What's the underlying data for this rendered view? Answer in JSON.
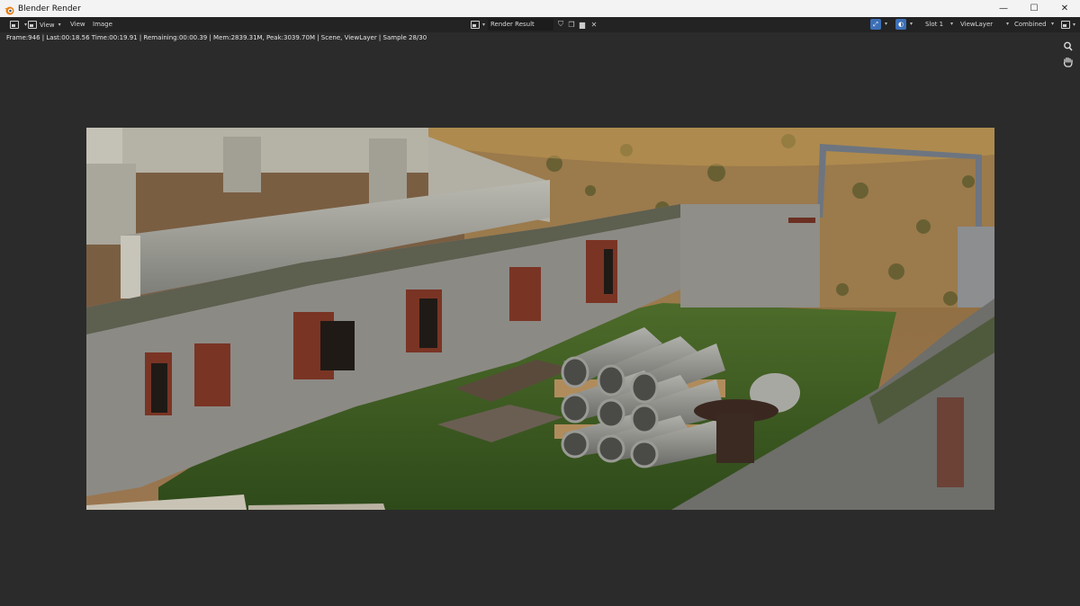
{
  "window": {
    "title": "Blender Render",
    "minimize": "—",
    "maximize": "☐",
    "close": "✕"
  },
  "header": {
    "menus": [
      "View",
      "View",
      "Image"
    ],
    "image_name": "Render Result",
    "slot": "Slot 1",
    "view_layer": "ViewLayer",
    "pass": "Combined"
  },
  "status": {
    "text": "Frame:946 | Last:00:18.56 Time:00:19.91 | Remaining:00:00.39 | Mem:2839.31M, Peak:3039.70M | Scene, ViewLayer | Sample 28/30"
  },
  "colors": {
    "background": "#2b2b2b",
    "header": "#232323",
    "accent": "#3d6fb6"
  }
}
